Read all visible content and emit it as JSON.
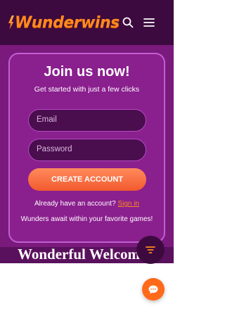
{
  "header": {
    "logo_text": "Wunderwins",
    "search_icon": "search-icon",
    "menu_icon": "hamburger-menu-icon"
  },
  "signup": {
    "title": "Join us now!",
    "subtitle": "Get started with just a few clicks",
    "email_placeholder": "Email",
    "password_placeholder": "Password",
    "cta_label": "CREATE ACCOUNT",
    "already_text": "Already have an account?",
    "signin_label": "Sign in",
    "tagline": "Wunders await within your favorite games!"
  },
  "banner": {
    "welcome_text": "Wonderful Welcome"
  },
  "floating": {
    "filter_icon": "filter-icon",
    "chat_icon": "chat-icon"
  },
  "colors": {
    "header_bg": "#3d0a3f",
    "page_bg": "#7a1a7d",
    "accent": "#ff8a1e",
    "cta_gradient_top": "#ff8a5c",
    "cta_gradient_bottom": "#f25a2e"
  }
}
